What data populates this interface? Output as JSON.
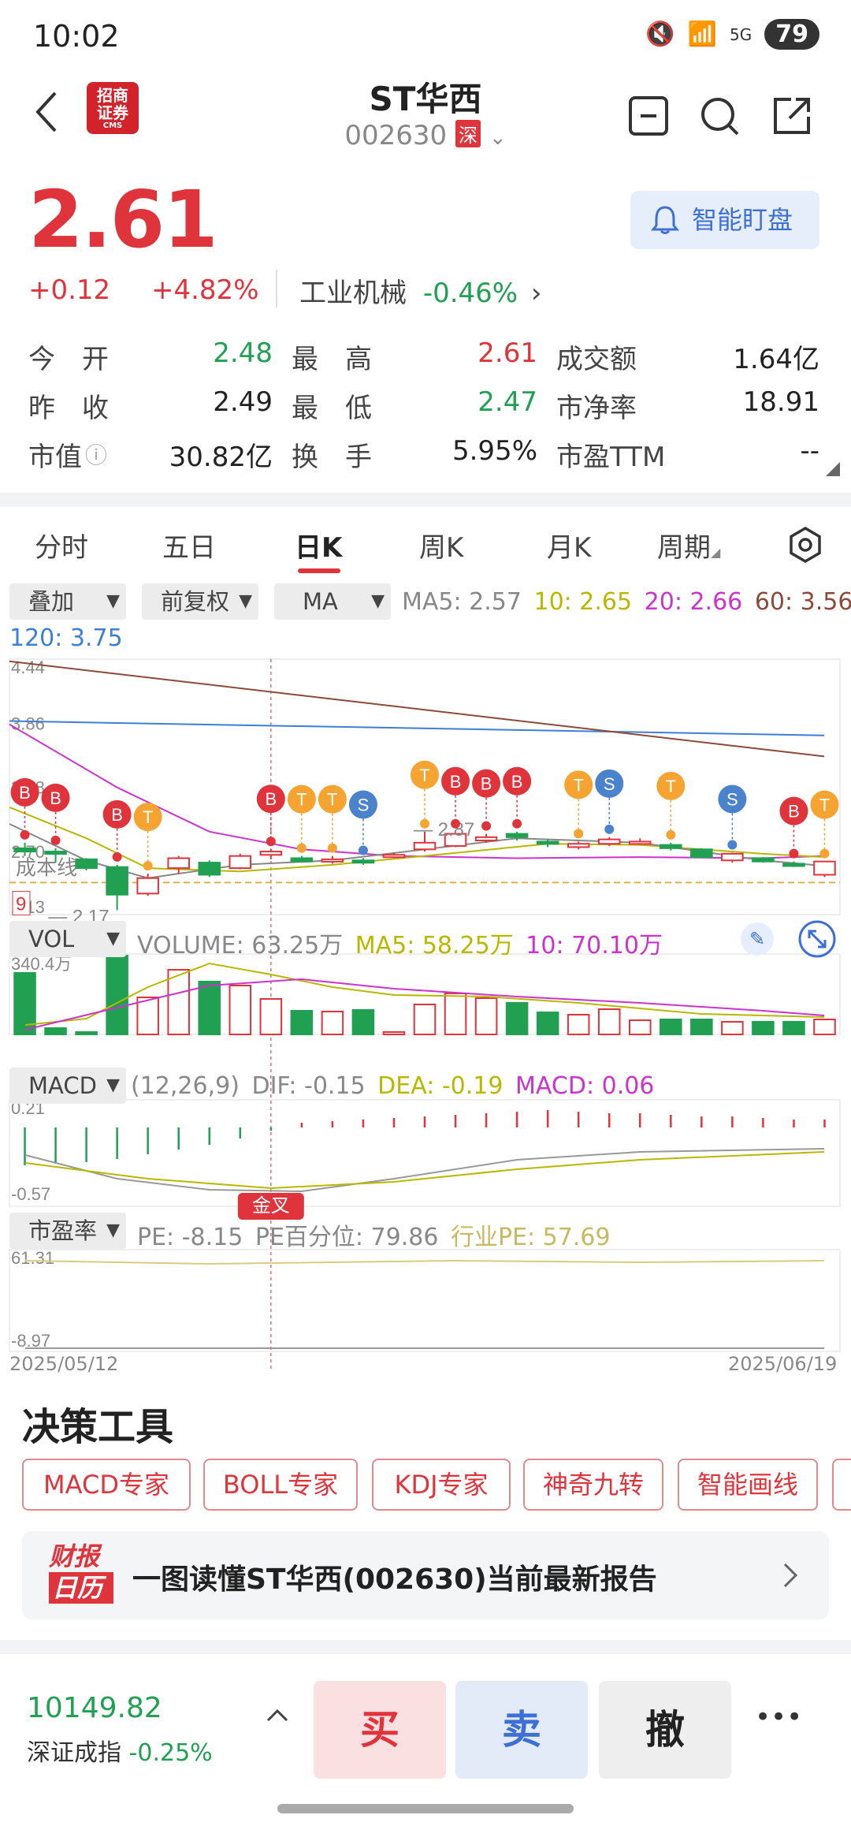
{
  "status_bar": {
    "time": "10:02",
    "network": "5G",
    "battery": "79"
  },
  "header": {
    "broker_logo_text": "招商证券",
    "broker_logo_sub": "CMS",
    "title": "ST华西",
    "code": "002630",
    "exchange": "深"
  },
  "quote": {
    "price": "2.61",
    "change": "+0.12",
    "change_pct": "+4.82%",
    "industry": "工业机械",
    "industry_change": "-0.46%",
    "smart_watch_label": "智能盯盘",
    "stats": [
      {
        "label": "今　开",
        "value": "2.48",
        "color": "green"
      },
      {
        "label": "最　高",
        "value": "2.61",
        "color": "red"
      },
      {
        "label": "成交额",
        "value": "1.64亿",
        "color": "black"
      },
      {
        "label": "昨　收",
        "value": "2.49",
        "color": "black"
      },
      {
        "label": "最　低",
        "value": "2.47",
        "color": "green"
      },
      {
        "label": "市净率",
        "value": "18.91",
        "color": "black"
      },
      {
        "label": "市值",
        "value": "30.82亿",
        "color": "black"
      },
      {
        "label": "换　手",
        "value": "5.95%",
        "color": "black"
      },
      {
        "label": "市盈TTM",
        "value": "--",
        "color": "black"
      }
    ]
  },
  "tabs": [
    "分时",
    "五日",
    "日K",
    "周K",
    "月K",
    "周期"
  ],
  "active_tab": "日K",
  "kline_controls": {
    "overlay": "叠加",
    "adjust": "前复权",
    "indicator": "MA"
  },
  "ma_values": {
    "ma5": "MA5: 2.57",
    "ma10": "10: 2.65",
    "ma20": "20: 2.66",
    "ma60": "60: 3.56",
    "ma120": "120: 3.75"
  },
  "colors": {
    "red": "#e0343c",
    "green": "#21a052",
    "ma5": "#888888",
    "ma10": "#b8b800",
    "ma20": "#cc33cc",
    "ma60": "#8b4a3a",
    "ma120": "#3d7fd6",
    "signal_b": "#e0343c",
    "signal_t": "#f5a331",
    "signal_s": "#4a82cc"
  },
  "chart_labels": {
    "y_max": "4.44",
    "y_3": "3.86",
    "y_2": "3.28",
    "y_1": "2.70",
    "y_min": "2.13",
    "low_label": "2.17",
    "mid_label": "2.87",
    "cost_line": "成本线",
    "nine_badge": "9"
  },
  "chart_data": {
    "type": "candlestick",
    "dates_start": "2025/05/12",
    "dates_end": "2025/06/19",
    "ylim": [
      2.13,
      4.44
    ],
    "candles": [
      {
        "o": 2.73,
        "c": 2.7,
        "h": 2.78,
        "l": 2.66
      },
      {
        "o": 2.7,
        "c": 2.69,
        "h": 2.73,
        "l": 2.6
      },
      {
        "o": 2.63,
        "c": 2.55,
        "h": 2.64,
        "l": 2.53
      },
      {
        "o": 2.56,
        "c": 2.31,
        "h": 2.58,
        "l": 2.17
      },
      {
        "o": 2.32,
        "c": 2.46,
        "h": 2.5,
        "l": 2.3
      },
      {
        "o": 2.55,
        "c": 2.64,
        "h": 2.66,
        "l": 2.5
      },
      {
        "o": 2.6,
        "c": 2.49,
        "h": 2.62,
        "l": 2.47
      },
      {
        "o": 2.55,
        "c": 2.66,
        "h": 2.68,
        "l": 2.54
      },
      {
        "o": 2.67,
        "c": 2.7,
        "h": 2.72,
        "l": 2.63
      },
      {
        "o": 2.64,
        "c": 2.61,
        "h": 2.66,
        "l": 2.6
      },
      {
        "o": 2.62,
        "c": 2.63,
        "h": 2.66,
        "l": 2.59
      },
      {
        "o": 2.62,
        "c": 2.6,
        "h": 2.64,
        "l": 2.58
      },
      {
        "o": 2.66,
        "c": 2.67,
        "h": 2.69,
        "l": 2.64
      },
      {
        "o": 2.72,
        "c": 2.78,
        "h": 2.88,
        "l": 2.7
      },
      {
        "o": 2.75,
        "c": 2.86,
        "h": 2.88,
        "l": 2.74
      },
      {
        "o": 2.8,
        "c": 2.83,
        "h": 2.86,
        "l": 2.78
      },
      {
        "o": 2.86,
        "c": 2.83,
        "h": 2.88,
        "l": 2.8
      },
      {
        "o": 2.79,
        "c": 2.77,
        "h": 2.81,
        "l": 2.74
      },
      {
        "o": 2.74,
        "c": 2.77,
        "h": 2.79,
        "l": 2.72
      },
      {
        "o": 2.77,
        "c": 2.81,
        "h": 2.83,
        "l": 2.75
      },
      {
        "o": 2.79,
        "c": 2.79,
        "h": 2.82,
        "l": 2.76
      },
      {
        "o": 2.76,
        "c": 2.73,
        "h": 2.78,
        "l": 2.71
      },
      {
        "o": 2.72,
        "c": 2.65,
        "h": 2.73,
        "l": 2.64
      },
      {
        "o": 2.62,
        "c": 2.68,
        "h": 2.69,
        "l": 2.6
      },
      {
        "o": 2.64,
        "c": 2.61,
        "h": 2.65,
        "l": 2.6
      },
      {
        "o": 2.59,
        "c": 2.57,
        "h": 2.61,
        "l": 2.56
      },
      {
        "o": 2.49,
        "c": 2.61,
        "h": 2.61,
        "l": 2.47
      }
    ],
    "signals": [
      {
        "i": 0,
        "t": "B"
      },
      {
        "i": 1,
        "t": "B"
      },
      {
        "i": 3,
        "t": "B"
      },
      {
        "i": 4,
        "t": "T"
      },
      {
        "i": 8,
        "t": "B"
      },
      {
        "i": 9,
        "t": "T"
      },
      {
        "i": 10,
        "t": "T"
      },
      {
        "i": 11,
        "t": "S"
      },
      {
        "i": 13,
        "t": "T"
      },
      {
        "i": 14,
        "t": "B"
      },
      {
        "i": 15,
        "t": "B"
      },
      {
        "i": 16,
        "t": "B"
      },
      {
        "i": 18,
        "t": "T"
      },
      {
        "i": 19,
        "t": "S"
      },
      {
        "i": 21,
        "t": "T"
      },
      {
        "i": 23,
        "t": "S"
      },
      {
        "i": 25,
        "t": "B"
      },
      {
        "i": 26,
        "t": "T"
      }
    ],
    "volume_ylim_max": "340.4万",
    "volume": [
      0.78,
      0.08,
      0.02,
      1.0,
      0.47,
      0.82,
      0.67,
      0.62,
      0.45,
      0.3,
      0.29,
      0.31,
      0.02,
      0.38,
      0.52,
      0.46,
      0.4,
      0.28,
      0.25,
      0.32,
      0.18,
      0.19,
      0.19,
      0.16,
      0.16,
      0.16,
      0.19
    ],
    "macd_ylim": [
      "0.21",
      "-0.57"
    ],
    "pe_ylim": [
      "61.31",
      "-8.97"
    ]
  },
  "volume_header": {
    "select": "VOL",
    "volume": "VOLUME: 63.25万",
    "ma5": "MA5: 58.25万",
    "ma10": "10: 70.10万"
  },
  "macd_header": {
    "select": "MACD",
    "params": "(12,26,9)",
    "dif": "DIF: -0.15",
    "dea": "DEA: -0.19",
    "macd": "MACD: 0.06",
    "golden_cross": "金叉"
  },
  "pe_header": {
    "select": "市盈率",
    "pe": "PE: -8.15",
    "pe_pct": "PE百分位: 79.86",
    "ind_pe": "行业PE: 57.69"
  },
  "decision_tools": {
    "title": "决策工具",
    "items": [
      "MACD专家",
      "BOLL专家",
      "KDJ专家",
      "神奇九转",
      "智能画线"
    ]
  },
  "report": {
    "logo_top": "财报",
    "logo_bottom": "日历",
    "text": "一图读懂ST华西(002630)当前最新报告"
  },
  "bottom_bar": {
    "index_value": "10149.82",
    "index_name": "深证成指",
    "index_change": "-0.25%",
    "buy": "买",
    "sell": "卖",
    "cancel": "撤",
    "more": "•••"
  }
}
